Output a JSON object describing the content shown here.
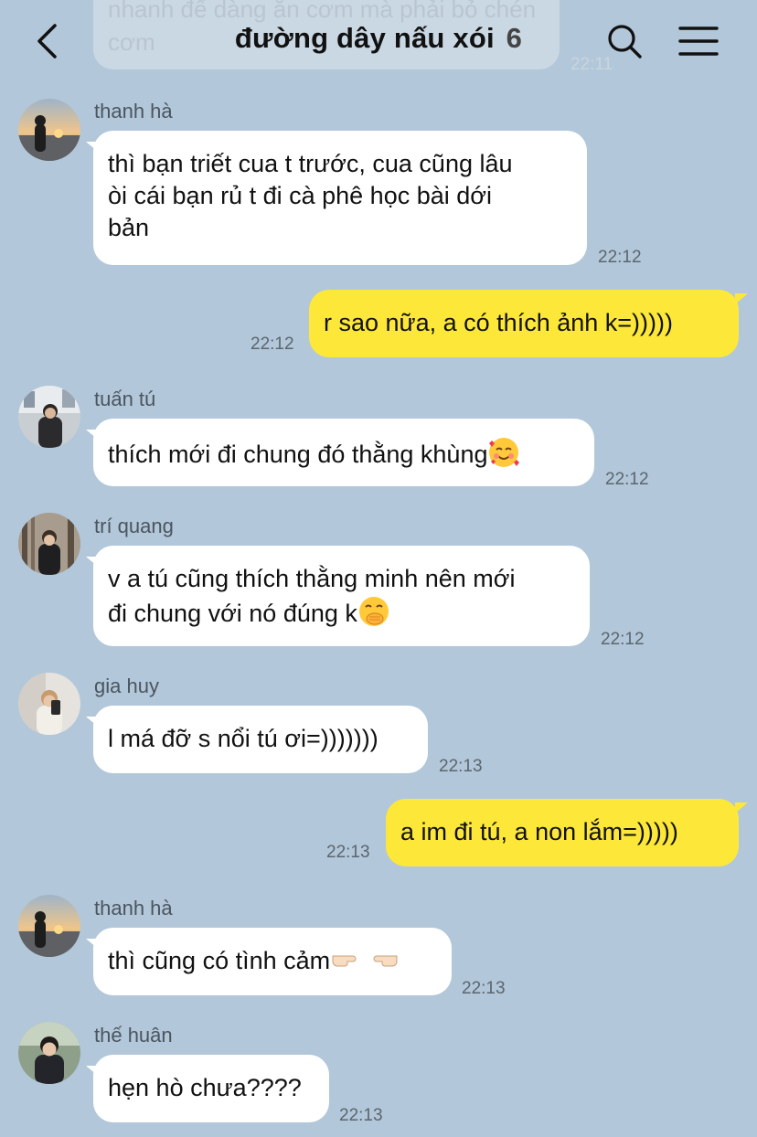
{
  "header": {
    "title": "đường dây nấu xói",
    "member_count": "6"
  },
  "previous_message": {
    "text": "nhanh để dàng ăn cơm mà phải bỏ chén cơm",
    "time": "22:11"
  },
  "messages": [
    {
      "sender": "thanh hà",
      "text": "thì bạn triết cua t trước, cua cũng lâu\nòi cái bạn rủ t đi cà phê học bài dới\nbản",
      "time": "22:12"
    },
    {
      "sender": "",
      "text": "r sao nữa, a có thích ảnh k=)))))",
      "time": "22:12"
    },
    {
      "sender": "tuấn tú",
      "text": "thích mới đi chung đó thằng khùng",
      "emoji": "smiling-face-with-hearts-emoji",
      "time": "22:12"
    },
    {
      "sender": "trí quang",
      "text_line1": "v a tú cũng thích thằng minh nên mới",
      "text_line2": "đi chung với nó đúng k",
      "emoji": "hand-over-mouth-emoji",
      "time": "22:12"
    },
    {
      "sender": "gia huy",
      "text": "l má đỡ s nổi tú ơi=)))))))",
      "time": "22:13"
    },
    {
      "sender": "",
      "text": "a im đi tú, a non lắm=)))))",
      "time": "22:13"
    },
    {
      "sender": "thanh hà",
      "text": "thì cũng có tình cảm",
      "emoji": "pointing-hands-emoji",
      "time": "22:13"
    },
    {
      "sender": "thế huân",
      "text": "hẹn hò chưa????",
      "time": "22:13"
    }
  ],
  "colors": {
    "background": "#b2c7d9",
    "incoming_bubble": "#ffffff",
    "outgoing_bubble": "#fde83a"
  }
}
